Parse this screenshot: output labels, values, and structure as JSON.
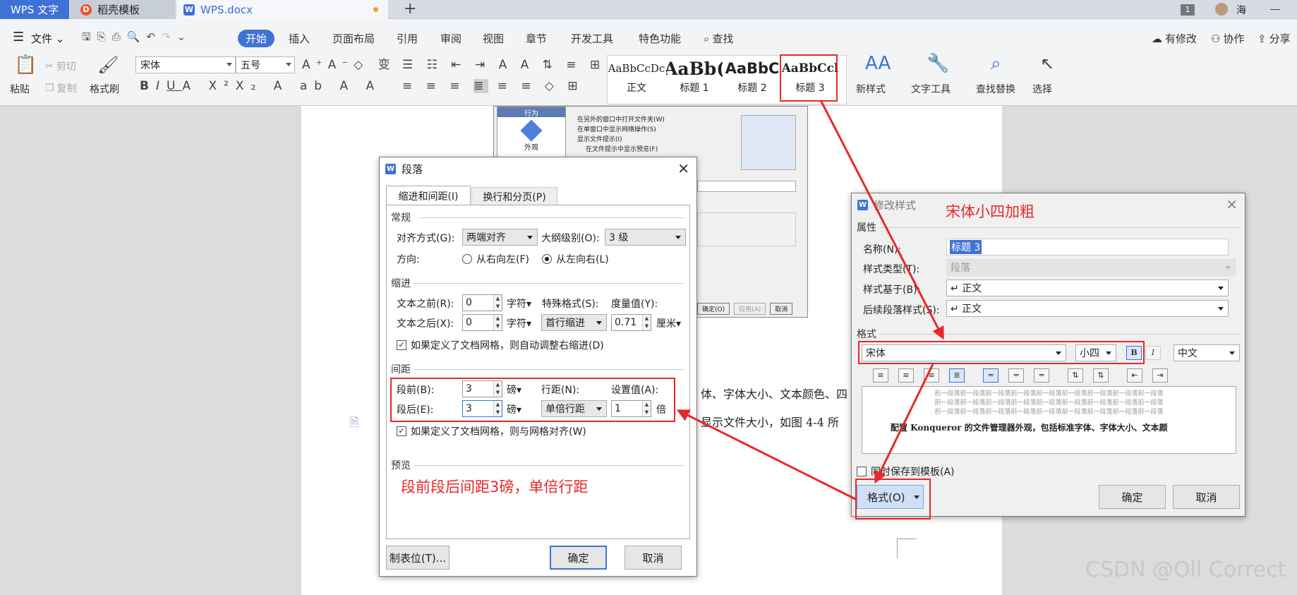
{
  "titlebar": {
    "app_tab": "WPS 文字",
    "template_tab": "稻壳模板",
    "doc_tab": "WPS.docx",
    "new_tab": "+",
    "window_count": "1",
    "user_name": "海"
  },
  "menubar": {
    "file": "文件",
    "items": [
      "开始",
      "插入",
      "页面布局",
      "引用",
      "审阅",
      "视图",
      "章节",
      "开发工具",
      "特色功能"
    ],
    "search": "查找",
    "right": [
      "有修改",
      "协作",
      "分享"
    ]
  },
  "ribbon": {
    "paste": "粘贴",
    "cut": "剪切",
    "copy": "复制",
    "format_painter": "格式刷",
    "font_name": "宋体",
    "font_size": "五号",
    "styles": [
      {
        "sample": "AaBbCcDc",
        "label": "正文"
      },
      {
        "sample": "AaBb(",
        "label": "标题 1"
      },
      {
        "sample": "AaBbC",
        "label": "标题 2"
      },
      {
        "sample": "AaBbCcl",
        "label": "标题 3"
      }
    ],
    "new_style": "新样式",
    "text_tools": "文字工具",
    "find_replace": "查找替换",
    "select": "选择"
  },
  "document": {
    "line1": "体、字体大小、文本颜色、四",
    "line2": "显示文件大小，如图 4-4 所"
  },
  "embedded_screenshot": {
    "sidebar_header": "行为",
    "sidebar_item": "外观",
    "options": [
      "在另外的窗口中打开文件夹(W)",
      "在单窗口中显示网络操作(S)",
      "显示文件提示(I)",
      "在文件提示中显示预览(F)"
    ],
    "buttons": [
      "确定(O)",
      "应用(A)",
      "取消"
    ]
  },
  "paragraph_dialog": {
    "title": "段落",
    "tabs": [
      "缩进和间距(I)",
      "换行和分页(P)"
    ],
    "general": "常规",
    "align_label": "对齐方式(G):",
    "align_value": "两端对齐",
    "outline_label": "大纲级别(O):",
    "outline_value": "3 级",
    "direction_label": "方向:",
    "rtl": "从右向左(F)",
    "ltr": "从左向右(L)",
    "indent": "缩进",
    "before_text_label": "文本之前(R):",
    "before_text_value": "0",
    "after_text_label": "文本之后(X):",
    "after_text_value": "0",
    "unit_char": "字符",
    "special_label": "特殊格式(S):",
    "special_value": "首行缩进",
    "measure_label": "度量值(Y):",
    "measure_value": "0.71",
    "unit_cm": "厘米",
    "auto_indent": "如果定义了文档网格，则自动调整右缩进(D)",
    "spacing": "间距",
    "before_label": "段前(B):",
    "before_value": "3",
    "after_label": "段后(E):",
    "after_value": "3",
    "unit_pt": "磅",
    "line_label": "行距(N):",
    "line_value": "单倍行距",
    "setting_label": "设置值(A):",
    "setting_value": "1",
    "unit_times": "倍",
    "grid_align": "如果定义了文档网格，则与网格对齐(W)",
    "preview": "预览",
    "tabs_button": "制表位(T)...",
    "ok": "确定",
    "cancel": "取消",
    "annotation": "段前段后间距3磅，单倍行距"
  },
  "style_dialog": {
    "title": "修改样式",
    "annotation": "宋体小四加粗",
    "properties": "属性",
    "name_label": "名称(N):",
    "name_value": "标题 3",
    "type_label": "样式类型(T):",
    "type_value": "段落",
    "based_label": "样式基于(B):",
    "based_value": "↵ 正文",
    "next_label": "后续段落样式(S):",
    "next_value": "↵ 正文",
    "format": "格式",
    "font": "宋体",
    "size": "小四",
    "bold": "B",
    "italic": "I",
    "lang": "中文",
    "preview_prev": "前一段落前一段落前一段落前一段落前一段落前一段落前一段落前一段落前一段落",
    "preview_sample": "配置 Konqueror 的文件管理器外观，包括标准字体、字体大小、文本颜",
    "save_to_template": "同时保存到模板(A)",
    "format_button": "格式(O)",
    "ok": "确定",
    "cancel": "取消"
  },
  "watermark": "CSDN @Oll Correct",
  "colors": {
    "accent": "#3f72d6",
    "annotation": "#e8272a"
  }
}
